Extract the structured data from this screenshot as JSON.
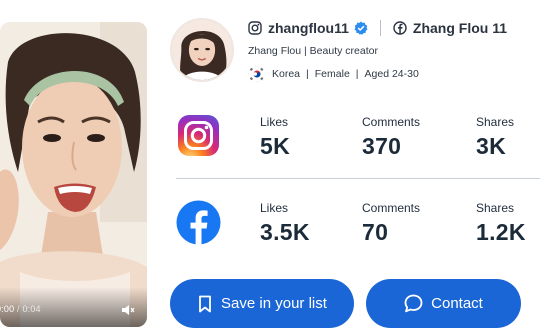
{
  "video": {
    "current_time": "0:00",
    "separator": " / ",
    "duration": "0:04"
  },
  "profile": {
    "instagram_handle": "zhangflou11",
    "facebook_name": "Zhang Flou 11",
    "bio": "Zhang Flou |  Beauty creator",
    "country": "Korea",
    "gender": "Female",
    "age": "Aged 24-30"
  },
  "stats": {
    "instagram": {
      "likes_label": "Likes",
      "likes": "5K",
      "comments_label": "Comments",
      "comments": "370",
      "shares_label": "Shares",
      "shares": "3K"
    },
    "facebook": {
      "likes_label": "Likes",
      "likes": "3.5K",
      "comments_label": "Comments",
      "comments": "70",
      "shares_label": "Shares",
      "shares": "1.2K"
    }
  },
  "actions": {
    "save_label": "Save in your list",
    "contact_label": "Contact"
  },
  "icons": {
    "instagram": "instagram-icon",
    "facebook": "facebook-icon",
    "verified": "verified-badge-icon",
    "flag": "south-korea-flag-icon",
    "bookmark": "bookmark-icon",
    "chat": "chat-bubble-icon",
    "volume": "volume-muted-icon"
  },
  "colors": {
    "primary_button": "#1a66d6",
    "facebook_blue": "#1877f2",
    "verified_blue": "#2d8cf0",
    "text_dark": "#1c2b39"
  }
}
